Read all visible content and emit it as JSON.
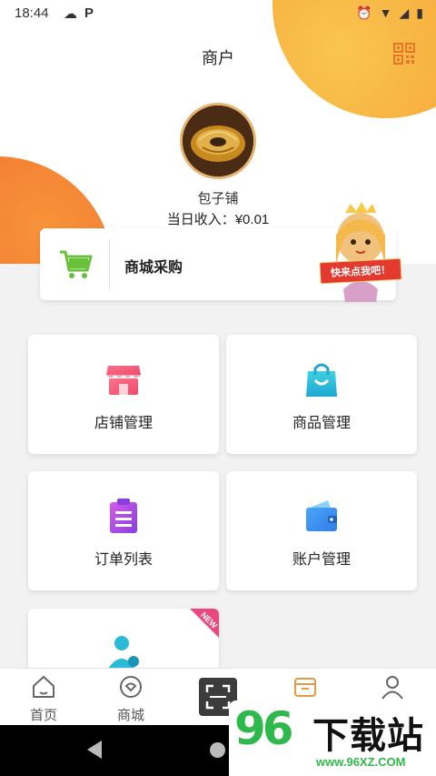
{
  "status_bar": {
    "time": "18:44",
    "left_icons": [
      "cloud-icon",
      "p-icon"
    ],
    "right_icons": [
      "alarm-icon",
      "wifi-icon",
      "signal-icon",
      "battery-icon"
    ]
  },
  "header": {
    "title": "商户",
    "qr_icon": "qr-code-icon"
  },
  "profile": {
    "shop_name": "包子铺",
    "income": "当日收入：¥0.01"
  },
  "mall_card": {
    "label": "商城采购",
    "mascot_sign": "快来点我吧！"
  },
  "tiles": [
    {
      "label": "店铺管理",
      "icon": "shop-icon"
    },
    {
      "label": "商品管理",
      "icon": "shopping-bag-icon"
    },
    {
      "label": "订单列表",
      "icon": "clipboard-icon"
    },
    {
      "label": "账户管理",
      "icon": "wallet-icon"
    },
    {
      "label": "",
      "icon": "user-settings-icon",
      "badge": "NEW"
    }
  ],
  "tabbar": [
    {
      "label": "首页",
      "icon": "home-icon"
    },
    {
      "label": "商城",
      "icon": "mall-icon"
    },
    {
      "label": "",
      "icon": "scan-icon"
    },
    {
      "label": "",
      "icon": "store-icon",
      "active": true
    },
    {
      "label": "",
      "icon": "profile-icon"
    }
  ],
  "watermark": {
    "number": "96",
    "text": "下载站",
    "url": "www.96XZ.COM"
  },
  "colors": {
    "accent_orange": "#f39a34",
    "mall_green": "#67c23a",
    "bag_teal": "#27c1d9",
    "clipboard_purple": "#b44be0",
    "shop_pink": "#f0567a",
    "wallet_blue": "#2f8df0",
    "active_tab": "#e39a44"
  }
}
